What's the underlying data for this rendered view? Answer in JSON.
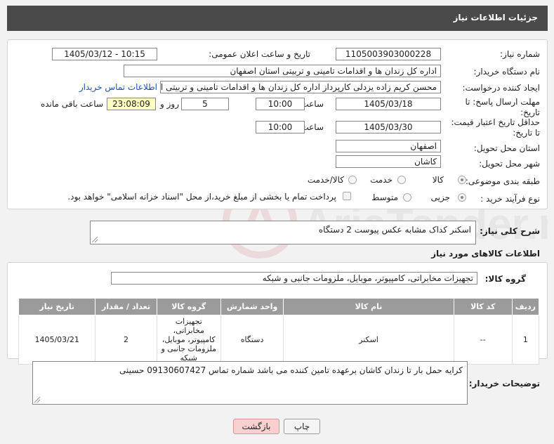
{
  "header": {
    "title": "جزئیات اطلاعات نیاز"
  },
  "form": {
    "need_number_label": "شماره نیاز:",
    "need_number": "1105003903000228",
    "announce_label": "تاریخ و ساعت اعلان عمومی:",
    "announce_value": "1405/03/12 - 10:15",
    "buyer_label": "نام دستگاه خریدار:",
    "buyer_value": "اداره کل زندان ها و اقدامات تامینی و تربیتی استان اصفهان",
    "creator_label": "ایجاد کننده درخواست:",
    "creator_value": "محسن کریم زاده یزدلی کارپرداز اداره کل زندان ها و اقدامات تامینی و تربیتی اس",
    "contact_link": "اطلاعات تماس خریدار",
    "deadline_label_1": "مهلت ارسال پاسخ: تا",
    "deadline_label_2": "تاریخ:",
    "deadline_date": "1405/03/18",
    "time_label": "ساعت",
    "deadline_time": "10:00",
    "days_value": "5",
    "days_label": "روز و",
    "remaining_time": "23:08:09",
    "remaining_label": "ساعت باقی مانده",
    "validity_label_1": "حداقل تاریخ اعتبار قیمت:",
    "validity_label_2": "تا تاریخ:",
    "validity_date": "1405/03/30",
    "validity_time": "10:00",
    "province_label": "استان محل تحویل:",
    "province_value": "اصفهان",
    "city_label": "شهر محل تحویل:",
    "city_value": "کاشان",
    "category_label": "طبقه بندی موضوعی:",
    "category_options": [
      "کالا",
      "خدمت",
      "کالا/خدمت"
    ],
    "category_selected": "کالا",
    "process_label": "نوع فرآیند خرید :",
    "process_options": [
      "جزیی",
      "متوسط"
    ],
    "payment_note": "پرداخت تمام یا بخشی از مبلغ خرید،از محل \"اسناد خزانه اسلامی\" خواهد بود."
  },
  "description": {
    "label": "شرح کلی نیاز:",
    "value": "اسکنر کداک مشابه عکس پیوست 2 دستگاه"
  },
  "goods": {
    "section_title": "اطلاعات کالاهای مورد نیاز",
    "group_label": "گروه کالا:",
    "group_value": "تجهیزات مخابراتی، کامپیوتر، موبایل، ملزومات جانبی و شبکه",
    "columns": [
      "ردیف",
      "کد کالا",
      "نام کالا",
      "واحد شمارش",
      "گروه کالا",
      "تعداد / مقدار",
      "تاریخ نیاز"
    ],
    "rows": [
      {
        "index": "1",
        "code": "--",
        "name": "اسکنر",
        "unit": "دستگاه",
        "group": "تجهیزات مخابراتی، کامپیوتر، موبایل، ملزومات جانبی و شبکه",
        "qty": "2",
        "date": "1405/03/21"
      }
    ]
  },
  "buyer_notes": {
    "label": "توضیحات خریدار:",
    "value": "کرایه حمل بار تا زندان کاشان برعهده تامین کننده می باشد شماره تماس 09130607427 حسینی"
  },
  "buttons": {
    "print": "چاپ",
    "back": "بازگشت"
  },
  "watermark_text": "AriaTender.net"
}
